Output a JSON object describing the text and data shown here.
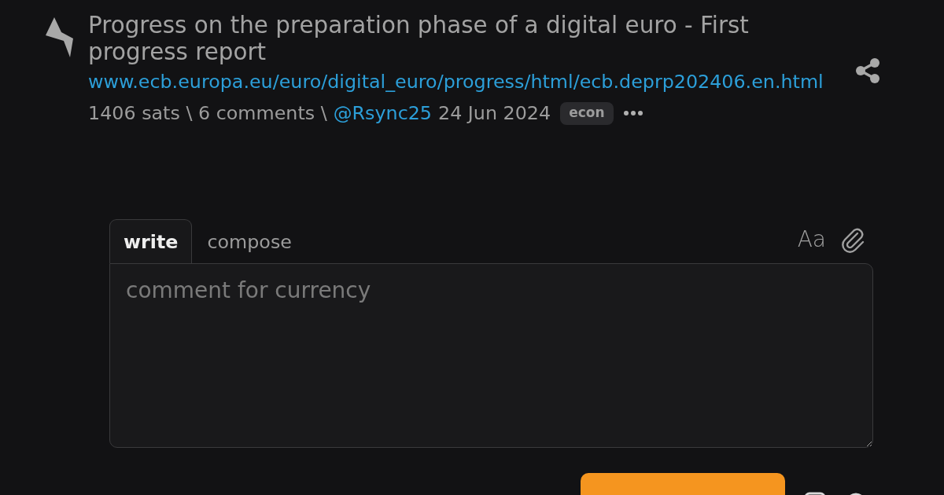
{
  "post": {
    "title": "Progress on the preparation phase of a digital euro - First progress report",
    "url": "www.ecb.europa.eu/euro/digital_euro/progress/html/ecb.deprp202406.en.html",
    "stats": "1406 sats \\ 6 comments \\",
    "author": "@Rsync25",
    "date": "24 Jun 2024",
    "tag": "econ"
  },
  "comment_form": {
    "tabs": [
      {
        "label": "write",
        "selected": true
      },
      {
        "label": "compose",
        "selected": false
      }
    ],
    "format_toggle": "Aa",
    "placeholder": "comment for currency"
  }
}
